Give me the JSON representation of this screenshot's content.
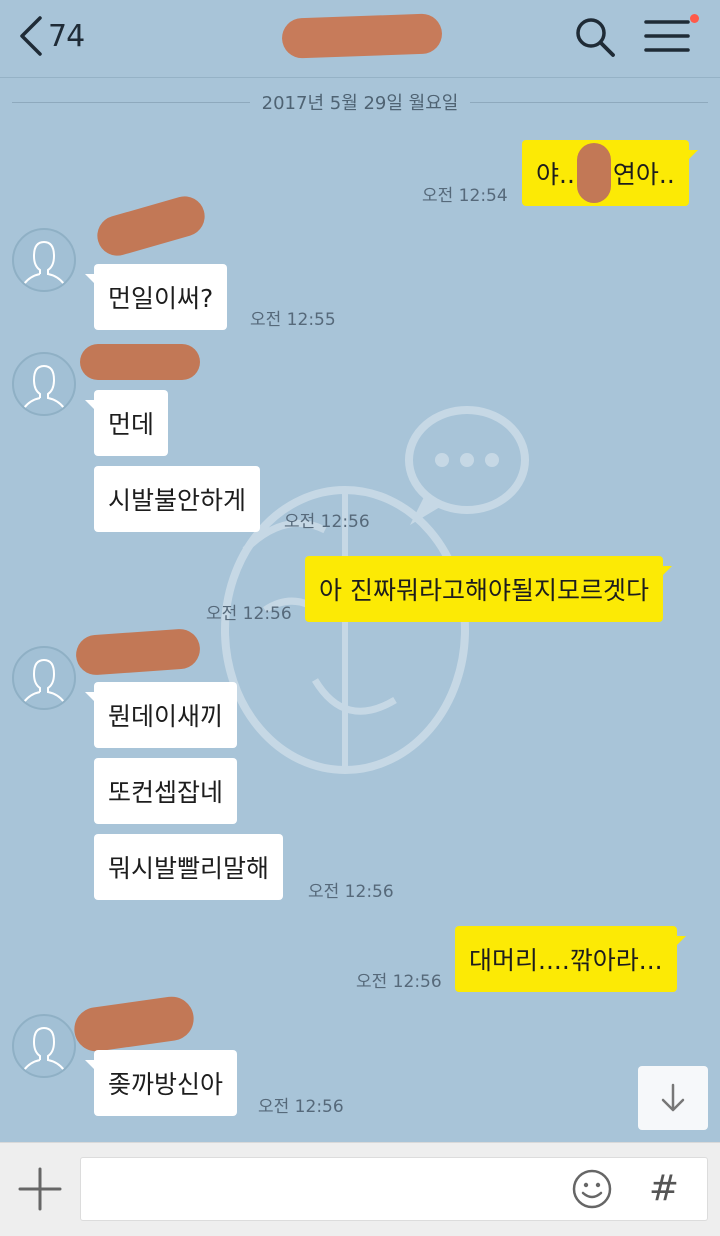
{
  "header": {
    "back_count": "74",
    "icons": [
      "chevron-left-icon",
      "search-icon",
      "menu-icon"
    ]
  },
  "date_separator": "2017년 5월 29일 월요일",
  "messages": [
    {
      "side": "right",
      "text_before": "야..",
      "text_after": "연아..",
      "time": "오전 12:54"
    },
    {
      "side": "left",
      "text": "먼일이써?",
      "time": "오전 12:55"
    },
    {
      "side": "left",
      "text": "먼데",
      "time": ""
    },
    {
      "side": "left",
      "text": "시발불안하게",
      "time": "오전 12:56"
    },
    {
      "side": "right",
      "text": "아 진짜뭐라고해야될지모르겟다",
      "time": "오전 12:56"
    },
    {
      "side": "left",
      "text": "뭔데이새끼",
      "time": ""
    },
    {
      "side": "left",
      "text": "또컨셉잡네",
      "time": ""
    },
    {
      "side": "left",
      "text": "뭐시발빨리말해",
      "time": "오전 12:56"
    },
    {
      "side": "right",
      "text": "대머리....깎아라...",
      "time": "오전 12:56"
    },
    {
      "side": "left",
      "text": "좆까방신아",
      "time": "오전 12:56"
    }
  ],
  "input": {
    "placeholder": "",
    "icons": [
      "plus-icon",
      "emoji-icon",
      "hashtag-icon"
    ],
    "hash_label": "#"
  },
  "colors": {
    "background": "#a8c4d8",
    "my_bubble": "#fcea05",
    "other_bubble": "#ffffff",
    "notification_dot": "#ff5a4a"
  }
}
